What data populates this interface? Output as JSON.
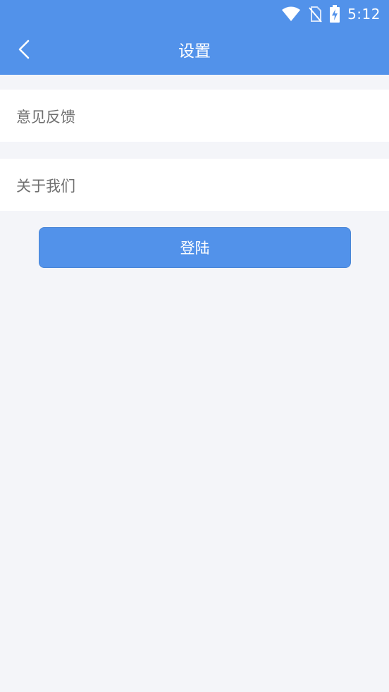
{
  "status_bar": {
    "time": "5:12",
    "icons": [
      "wifi-icon",
      "no-sim-icon",
      "battery-charging-icon"
    ]
  },
  "header": {
    "title": "设置",
    "back_icon": "chevron-left-icon"
  },
  "menu": {
    "items": [
      {
        "label": "意见反馈"
      },
      {
        "label": "关于我们"
      }
    ]
  },
  "login_button": {
    "label": "登陆"
  },
  "colors": {
    "primary": "#5292ea",
    "background": "#f4f5f9",
    "item_background": "#ffffff",
    "item_text": "#6f6f6f"
  }
}
